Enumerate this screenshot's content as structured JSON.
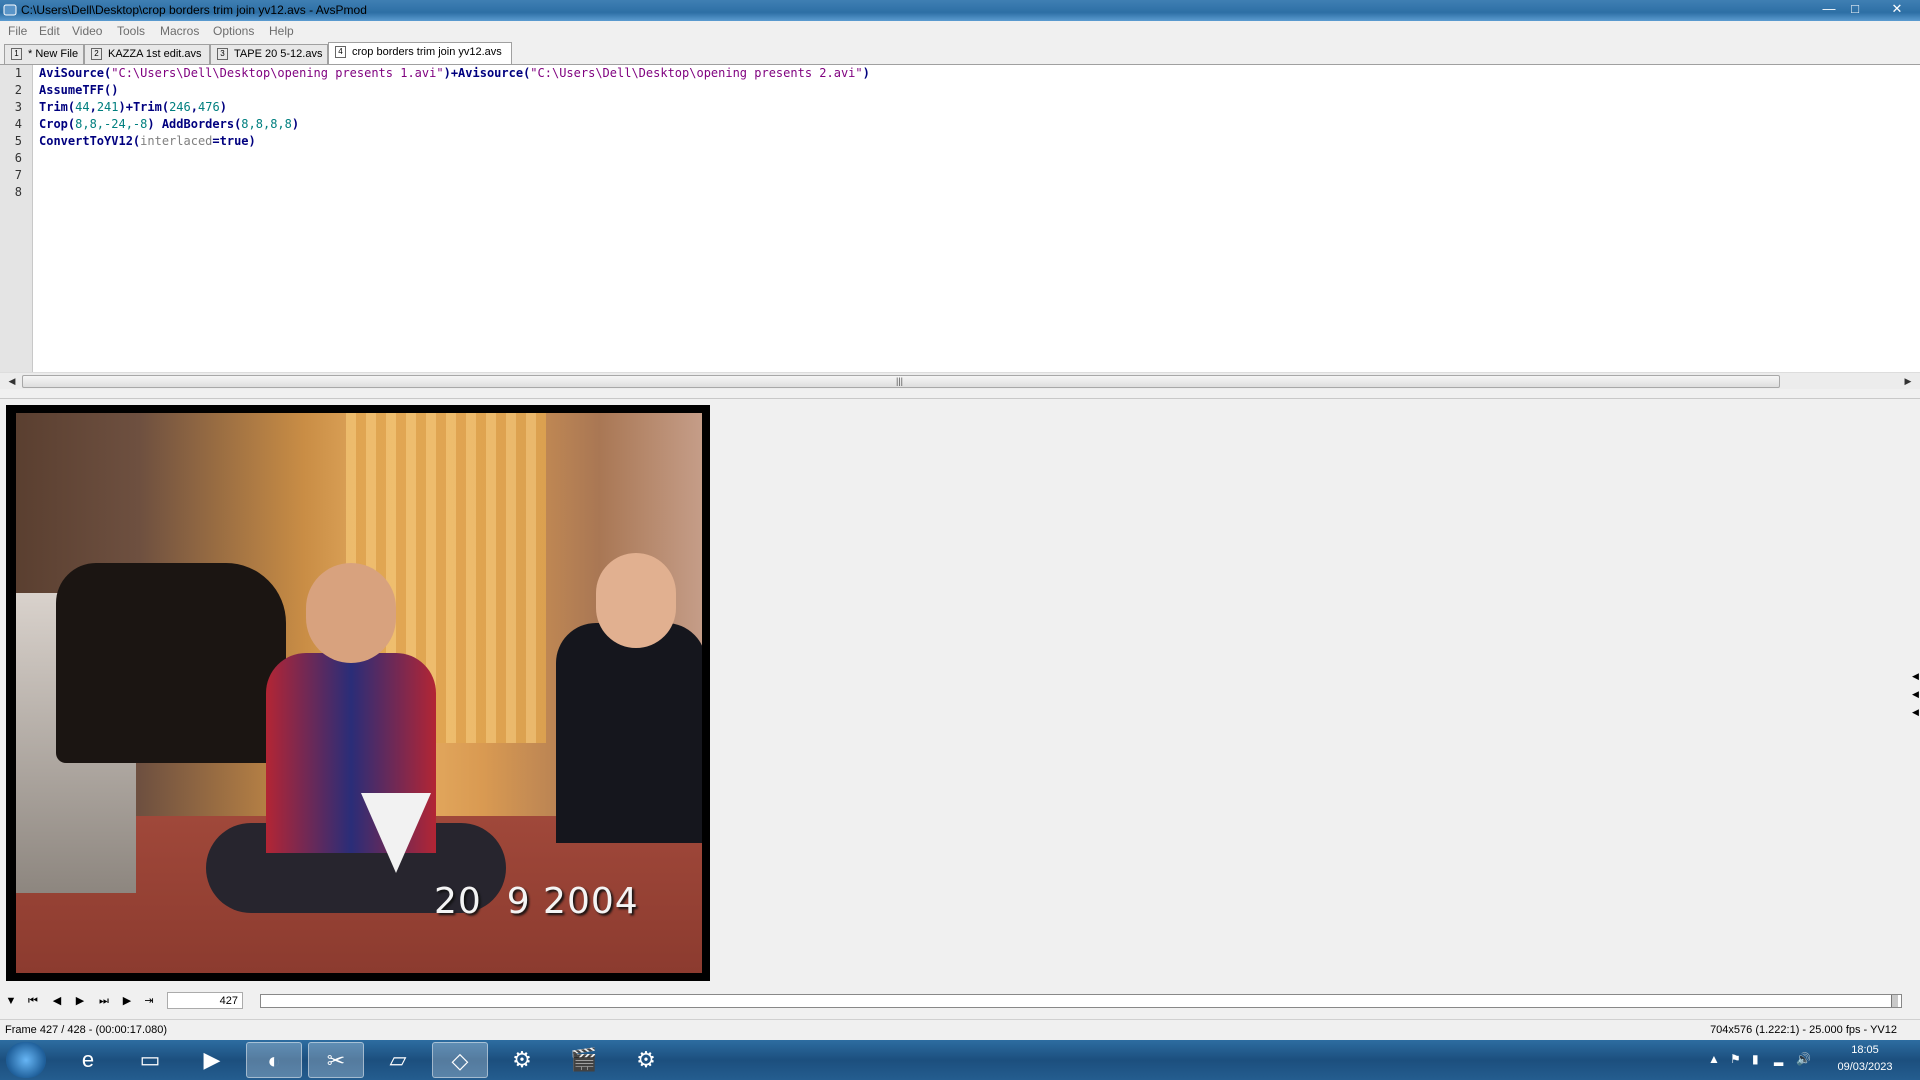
{
  "window": {
    "title": "C:\\Users\\Dell\\Desktop\\crop borders trim join yv12.avs - AvsPmod",
    "minimize": "—",
    "maximize": "□",
    "close": "✕"
  },
  "menu": [
    "File",
    "Edit",
    "Video",
    "Tools",
    "Macros",
    "Options",
    "Help"
  ],
  "tabs": [
    {
      "num": "1",
      "label": "* New File"
    },
    {
      "num": "2",
      "label": "KAZZA 1st edit.avs"
    },
    {
      "num": "3",
      "label": "TAPE 20 5-12.avs"
    },
    {
      "num": "4",
      "label": "crop borders trim join yv12.avs",
      "active": true
    }
  ],
  "editor": {
    "line_numbers": [
      "1",
      "2",
      "3",
      "4",
      "5",
      "6",
      "7",
      "8"
    ],
    "line1": {
      "f1": "AviSource(",
      "s1": "\"C:\\Users\\Dell\\Desktop\\opening presents 1.avi\"",
      "mid": ")+Avisource(",
      "s2": "\"C:\\Users\\Dell\\Desktop\\opening presents 2.avi\"",
      "end": ")"
    },
    "line2": {
      "f": "AssumeTFF()"
    },
    "line3": {
      "f1": "Trim(",
      "n1": "44",
      "c1": ",",
      "n2": "241",
      "mid": ")+Trim(",
      "n3": "246",
      "c2": ",",
      "n4": "476",
      "end": ")"
    },
    "line4": {
      "f1": "Crop(",
      "n1": "8,8,-24,-8",
      "mid": ") AddBorders(",
      "n2": "8,8,8,8",
      "end": ")"
    },
    "line5": {
      "f": "ConvertToYV12(",
      "arg": "interlaced",
      "eq": "=true)"
    }
  },
  "video": {
    "date_stamp": "20  9 2004"
  },
  "playback": {
    "frame_value": "427",
    "position_fraction": 0.998
  },
  "status": {
    "left": "Frame 427 / 428  -  (00:00:17.080)",
    "right": "704x576 (1.222:1)  -  25.000 fps  -  YV12"
  },
  "taskbar": {
    "time": "18:05",
    "date": "09/03/2023"
  }
}
